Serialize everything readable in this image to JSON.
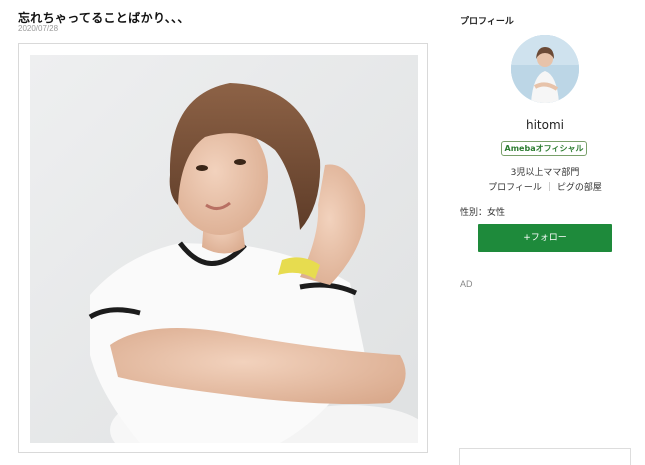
{
  "article": {
    "title": "忘れちゃってることばかり、、、",
    "date": "2020/07/28"
  },
  "sidebar": {
    "heading": "プロフィール",
    "name": "hitomi",
    "badge": "Amebaオフィシャル",
    "category": "3児以上ママ部門",
    "links": [
      "プロフィール",
      "ピグの部屋"
    ],
    "gender": "性別：女性",
    "follow_label": "+フォロー",
    "ad_label": "AD"
  },
  "colors": {
    "follow_button": "#1e8a3b",
    "badge_text": "#2e7d32",
    "avatar_background": "#bcd6e6"
  }
}
